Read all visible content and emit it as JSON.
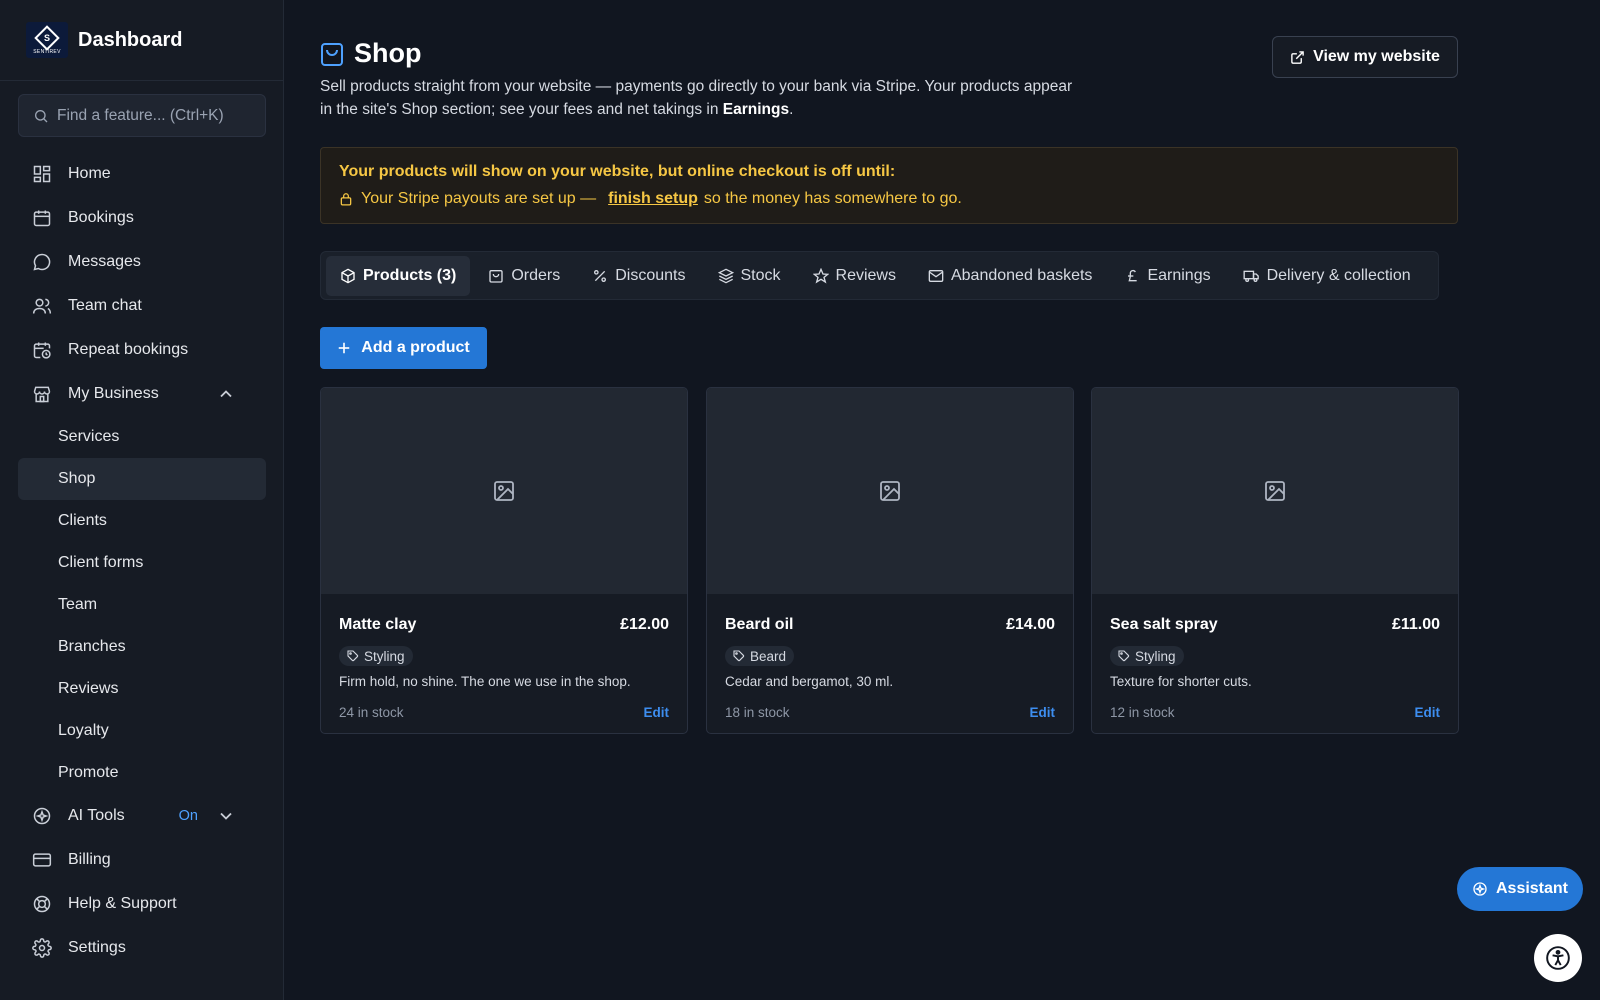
{
  "brand": {
    "title": "Dashboard",
    "logo_letter": "S",
    "logo_text": "SENTIREV"
  },
  "search": {
    "placeholder": "Find a feature... (Ctrl+K)"
  },
  "sidebar": {
    "items": [
      {
        "label": "Home",
        "icon": "grid-icon"
      },
      {
        "label": "Bookings",
        "icon": "calendar-icon"
      },
      {
        "label": "Messages",
        "icon": "chat-bubble-icon"
      },
      {
        "label": "Team chat",
        "icon": "users-icon"
      },
      {
        "label": "Repeat bookings",
        "icon": "calendar-clock-icon"
      },
      {
        "label": "My Business",
        "icon": "store-icon"
      }
    ],
    "business_sub": [
      "Services",
      "Shop",
      "Clients",
      "Client forms",
      "Team",
      "Branches",
      "Reviews",
      "Loyalty",
      "Promote"
    ],
    "active_sub": "Shop",
    "ai_tools": {
      "label": "AI Tools",
      "status": "On"
    },
    "bottom": [
      {
        "label": "Billing",
        "icon": "credit-card-icon"
      },
      {
        "label": "Help & Support",
        "icon": "lifebuoy-icon"
      },
      {
        "label": "Settings",
        "icon": "gear-icon"
      }
    ]
  },
  "page": {
    "title": "Shop",
    "desc_part1": "Sell products straight from your website — payments go directly to your bank via Stripe. Your products appear in the site's Shop section; see your fees and net takings in ",
    "desc_bold": "Earnings",
    "desc_end": ".",
    "view_button": "View my website"
  },
  "alert": {
    "title": "Your products will show on your website, but online checkout is off until:",
    "line_start": "Your Stripe payouts are set up —",
    "link": "finish setup",
    "line_end": "so the money has somewhere to go."
  },
  "tabs": [
    {
      "label": "Products (3)",
      "icon": "box-icon",
      "active": true
    },
    {
      "label": "Orders",
      "icon": "bag-icon"
    },
    {
      "label": "Discounts",
      "icon": "percent-icon"
    },
    {
      "label": "Stock",
      "icon": "layers-icon"
    },
    {
      "label": "Reviews",
      "icon": "star-icon"
    },
    {
      "label": "Abandoned baskets",
      "icon": "mail-icon"
    },
    {
      "label": "Earnings",
      "icon": "pound-icon"
    },
    {
      "label": "Delivery & collection",
      "icon": "truck-icon"
    }
  ],
  "add_button": "Add a product",
  "products": [
    {
      "name": "Matte clay",
      "price": "£12.00",
      "tag": "Styling",
      "desc": "Firm hold, no shine. The one we use in the shop.",
      "stock": "24 in stock",
      "edit": "Edit"
    },
    {
      "name": "Beard oil",
      "price": "£14.00",
      "tag": "Beard",
      "desc": "Cedar and bergamot, 30 ml.",
      "stock": "18 in stock",
      "edit": "Edit"
    },
    {
      "name": "Sea salt spray",
      "price": "£11.00",
      "tag": "Styling",
      "desc": "Texture for shorter cuts.",
      "stock": "12 in stock",
      "edit": "Edit"
    }
  ],
  "assistant_button": "Assistant",
  "colors": {
    "accent": "#2477d6",
    "warning": "#f6c744",
    "link": "#3d8ef0",
    "background": "#111620"
  }
}
